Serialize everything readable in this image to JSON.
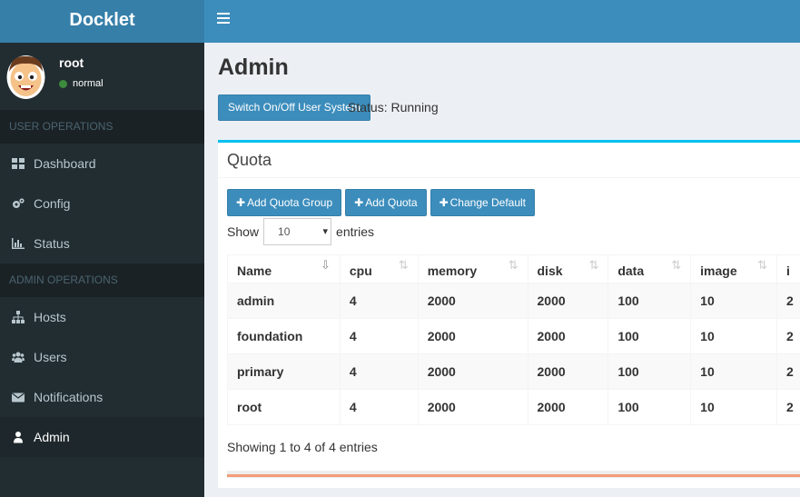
{
  "app": {
    "title": "Docklet"
  },
  "user": {
    "name": "root",
    "status": "normal"
  },
  "sidebar": {
    "user_section": "USER OPERATIONS",
    "user_items": [
      {
        "label": "Dashboard",
        "icon": "dashboard-icon"
      },
      {
        "label": "Config",
        "icon": "cogs-icon"
      },
      {
        "label": "Status",
        "icon": "bar-chart-icon"
      }
    ],
    "admin_section": "ADMIN OPERATIONS",
    "admin_items": [
      {
        "label": "Hosts",
        "icon": "sitemap-icon"
      },
      {
        "label": "Users",
        "icon": "users-icon"
      },
      {
        "label": "Notifications",
        "icon": "envelope-icon"
      },
      {
        "label": "Admin",
        "icon": "user-icon",
        "active": true
      }
    ]
  },
  "page": {
    "title": "Admin",
    "switch_button": "Switch On/Off User System",
    "status_text": "Status: Running"
  },
  "quota": {
    "title": "Quota",
    "buttons": {
      "add_group": "Add Quota Group",
      "add_quota": "Add Quota",
      "change_default": "Change Default"
    },
    "show_label": "Show",
    "page_size": "10",
    "entries_label": "entries",
    "columns": [
      "Name",
      "cpu",
      "memory",
      "disk",
      "data",
      "image",
      "i"
    ],
    "rows": [
      [
        "admin",
        "4",
        "2000",
        "2000",
        "100",
        "10",
        "2"
      ],
      [
        "foundation",
        "4",
        "2000",
        "2000",
        "100",
        "10",
        "2"
      ],
      [
        "primary",
        "4",
        "2000",
        "2000",
        "100",
        "10",
        "2"
      ],
      [
        "root",
        "4",
        "2000",
        "2000",
        "100",
        "10",
        "2"
      ]
    ],
    "info": "Showing 1 to 4 of 4 entries"
  },
  "colors": {
    "header": "#3c8dbc",
    "logo": "#367fa9",
    "sidebar": "#222d32",
    "box_accent": "#00c0ef"
  }
}
